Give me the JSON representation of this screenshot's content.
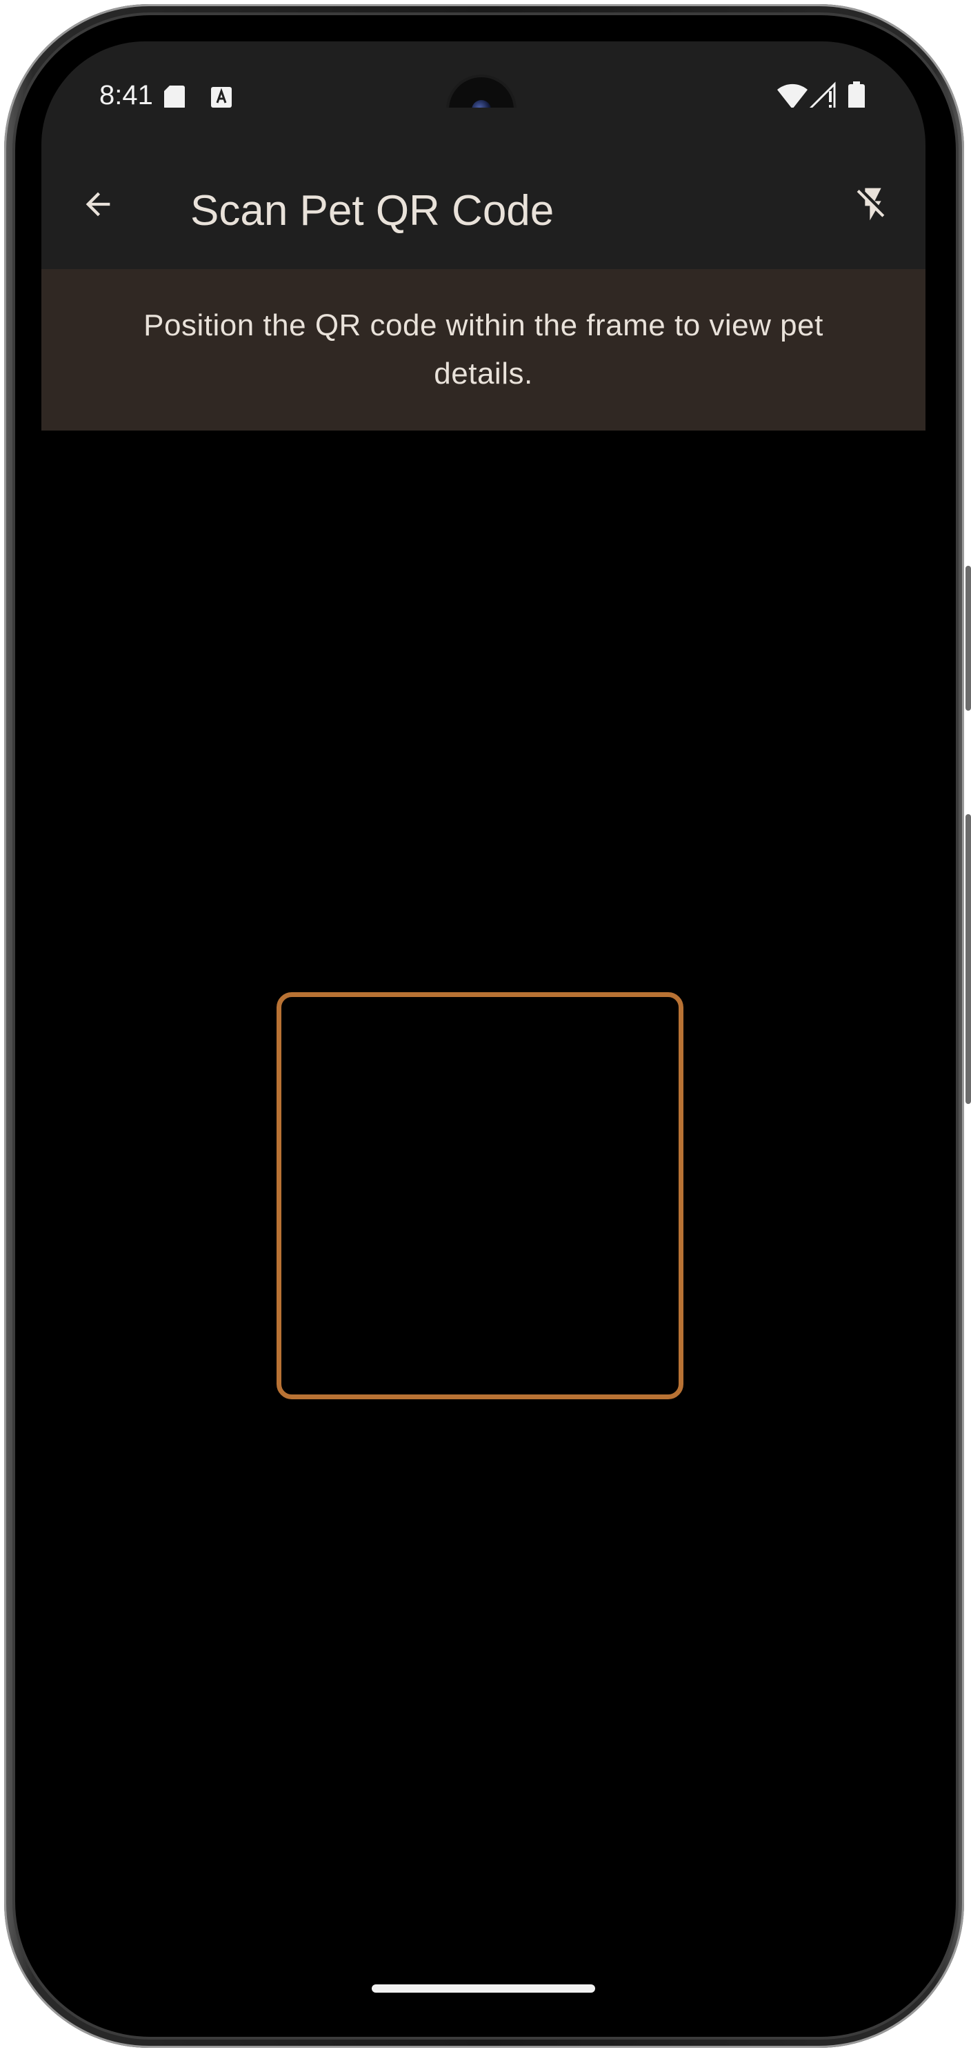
{
  "status_bar": {
    "time": "8:41",
    "icons": [
      "sd-card-icon",
      "a-notification-icon",
      "wifi-icon",
      "signal-icon",
      "battery-icon"
    ]
  },
  "app_bar": {
    "title": "Scan Pet QR Code",
    "back_icon": "arrow-back-icon",
    "flash_icon": "flash-off-icon"
  },
  "instruction": {
    "text": "Position the QR code within the frame to view pet details."
  },
  "colors": {
    "app_bar_bg": "#1f1f1f",
    "banner_bg": "#302823",
    "text": "#e9e2da",
    "frame_accent": "#b87234",
    "camera_bg": "#000000"
  }
}
